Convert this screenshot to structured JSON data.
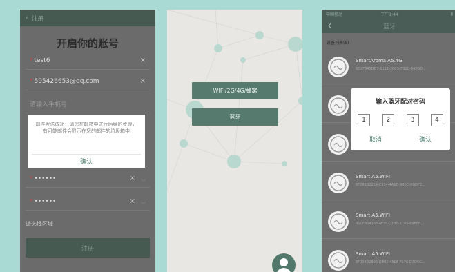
{
  "phone1": {
    "navbar": {
      "back_icon": "chevron-left-icon",
      "title": "注册"
    },
    "title": "开启你的账号",
    "fields": [
      {
        "required": "*",
        "value": "test6",
        "clear": "×"
      },
      {
        "required": "*",
        "value": "595426653@qq.com",
        "clear": "×"
      },
      {
        "placeholder": "请输入手机号"
      },
      {
        "required": "*",
        "value": "••••••",
        "clear": "×",
        "eye": "◡"
      },
      {
        "required": "*",
        "value": "••••••",
        "clear": "×",
        "eye": "◡"
      }
    ],
    "region_label": "请选择区域",
    "register_button": "注册",
    "dialog": {
      "message": "邮件发送成功，请您在邮箱中进行后续的步骤，有可能邮件会显示在您的邮件的垃圾箱中",
      "confirm": "确认"
    }
  },
  "phone2": {
    "buttons": [
      "WIFI/2G/4G/蜂窝",
      "蓝牙"
    ],
    "avatar_icon": "user-avatar-icon"
  },
  "phone3": {
    "status": {
      "carrier": "中国移动",
      "time": "下午1:44",
      "battery": "▮"
    },
    "navbar": {
      "back": "‹",
      "title": "蓝牙"
    },
    "list_header": "设备列表(8)",
    "devices": [
      {
        "name": "SmartAroma.A5.4G",
        "uuid": "5D2F845DD7-1111-20C3-7B2C-842GD..."
      },
      {
        "name": "",
        "uuid": ""
      },
      {
        "name": "",
        "uuid": ""
      },
      {
        "name": "Smart.A5.WIFI",
        "uuid": "6F28BB2254-C114-4A1D-9B0C-8GDF2..."
      },
      {
        "name": "Smart.A5.WIFI",
        "uuid": "B1CF854383-4F38-D1B0-3745-E9BEB..."
      },
      {
        "name": "Smart.A5.WIFI",
        "uuid": "8F034B2B03-DB02-4508-F376-D3D5C..."
      }
    ],
    "pin_dialog": {
      "title": "输入蓝牙配对密码",
      "digits": [
        "1",
        "2",
        "3",
        "4"
      ],
      "cancel": "取消",
      "confirm": "确认"
    }
  }
}
